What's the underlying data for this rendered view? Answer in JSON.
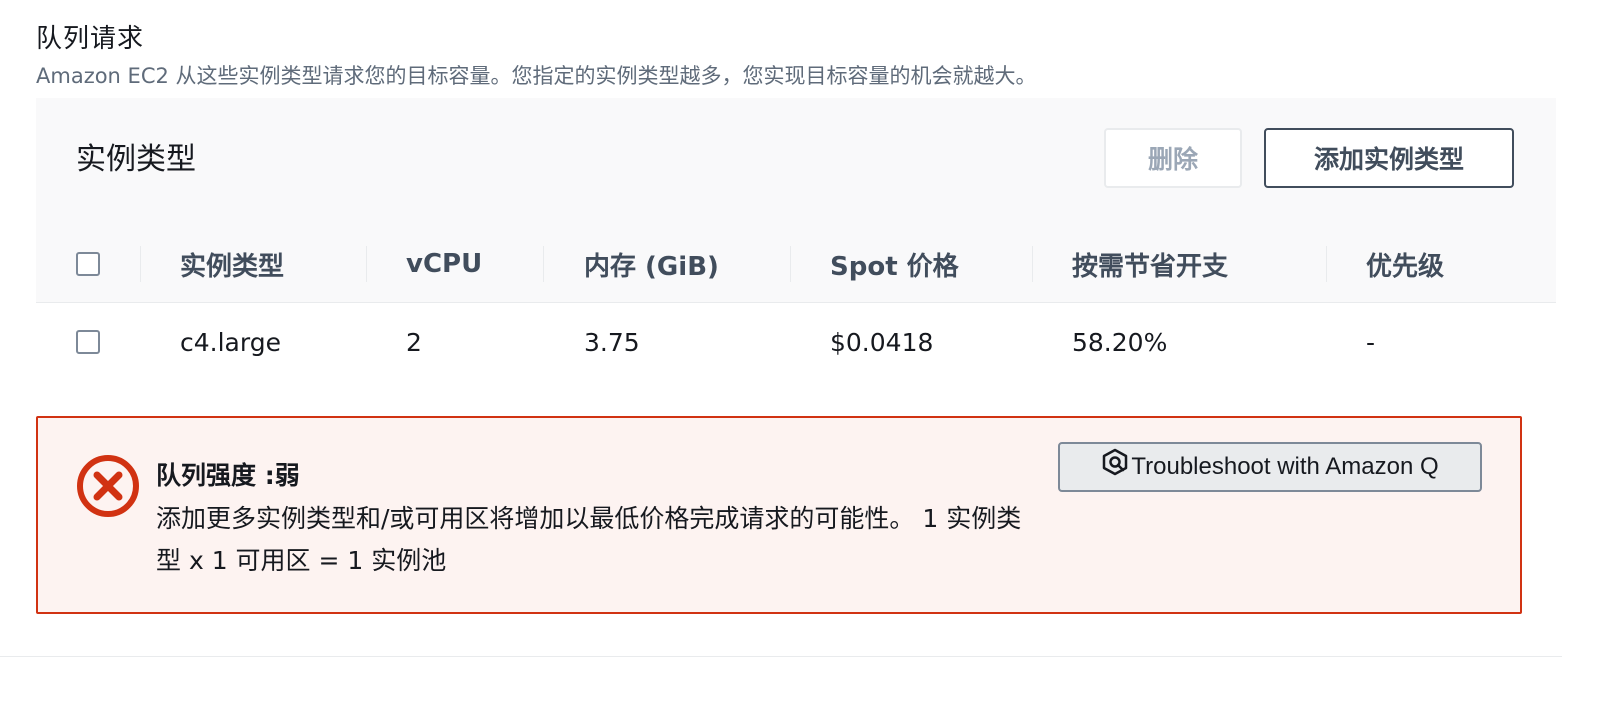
{
  "section": {
    "title": "队列请求",
    "description": "Amazon EC2 从这些实例类型请求您的目标容量。您指定的实例类型越多，您实现目标容量的机会就越大。"
  },
  "table": {
    "title": "实例类型",
    "delete_label": "删除",
    "add_label": "添加实例类型",
    "columns": [
      "实例类型",
      "vCPU",
      "内存 (GiB)",
      "Spot 价格",
      "按需节省开支",
      "优先级"
    ],
    "rows": [
      {
        "instance_type": "c4.large",
        "vcpu": "2",
        "memory": "3.75",
        "spot_price": "$0.0418",
        "savings": "58.20%",
        "priority": "-"
      }
    ]
  },
  "alert": {
    "title": "队列强度 :弱",
    "body": "添加更多实例类型和/或可用区将增加以最低价格完成请求的可能性。 1 实例类型 x 1 可用区 = 1 实例池",
    "button_label": "Troubleshoot with Amazon Q",
    "status_color": "#d13212",
    "icon": "error-circle-icon"
  }
}
